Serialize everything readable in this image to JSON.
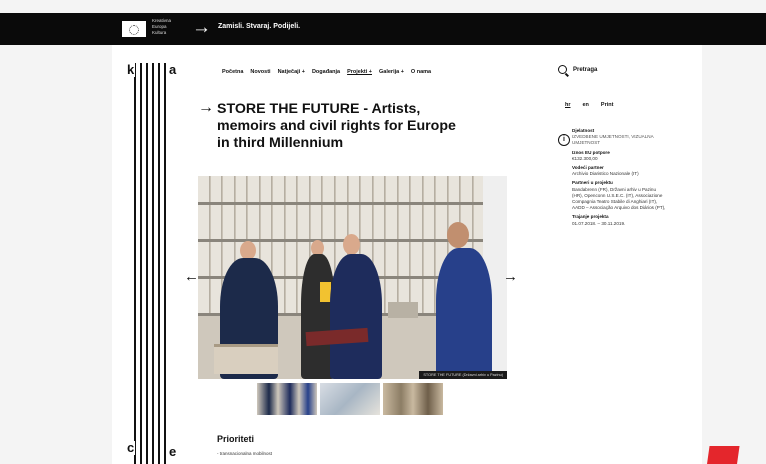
{
  "topbar": {
    "eu_label": "Kreativna Europa Kultura",
    "tagline": "Zamisli. Stvaraj. Podijeli."
  },
  "logo": {
    "top_text": "kultura",
    "bottom_text": "culture"
  },
  "nav": {
    "items": [
      "Početna",
      "Novosti",
      "Natječaji +",
      "Događanja",
      "Projekti +",
      "Galerija +",
      "O nama"
    ],
    "active_index": 4
  },
  "search": {
    "label": "Pretraga"
  },
  "language": {
    "options": [
      "hr",
      "en",
      "Print"
    ]
  },
  "project": {
    "title": "STORE THE FUTURE - Artists, memoirs and civil rights for Europe in third Millennium",
    "photo_caption": "STORE THE FUTURE (Državni arhiv u Pazinu)"
  },
  "sidebar": {
    "field_label": "Djelatnost",
    "field_value": "IZVEDBENE UMJETNOSTI, VIZUALNA UMJETNOST",
    "eu_amount_label": "Iznos EU potpore",
    "eu_amount_value": "€132.300,00",
    "lead_partner_label": "Vodeći partner",
    "lead_partner_value": "Archivio Diaristico Nazionale (IT)",
    "partners_label": "Partneri u projektu",
    "partners_value": "Bandabrenn (FR), Državni arhiv u Pazinu (HR), Openconn U.S.E.C. (IT), Associazione Compagnia Teatro Stabile di Anghiari (IT), AADD – Associação Arquivo dos Diários (PT),",
    "duration_label": "Trajanje projekta",
    "duration_value": "01.07.2018. – 30.11.2019."
  },
  "priorities": {
    "title": "Prioriteti",
    "items": [
      "- transnacionalna mobilnost"
    ]
  },
  "colors": {
    "accent_red": "#e4262c",
    "topbar": "#0a0a0a"
  }
}
